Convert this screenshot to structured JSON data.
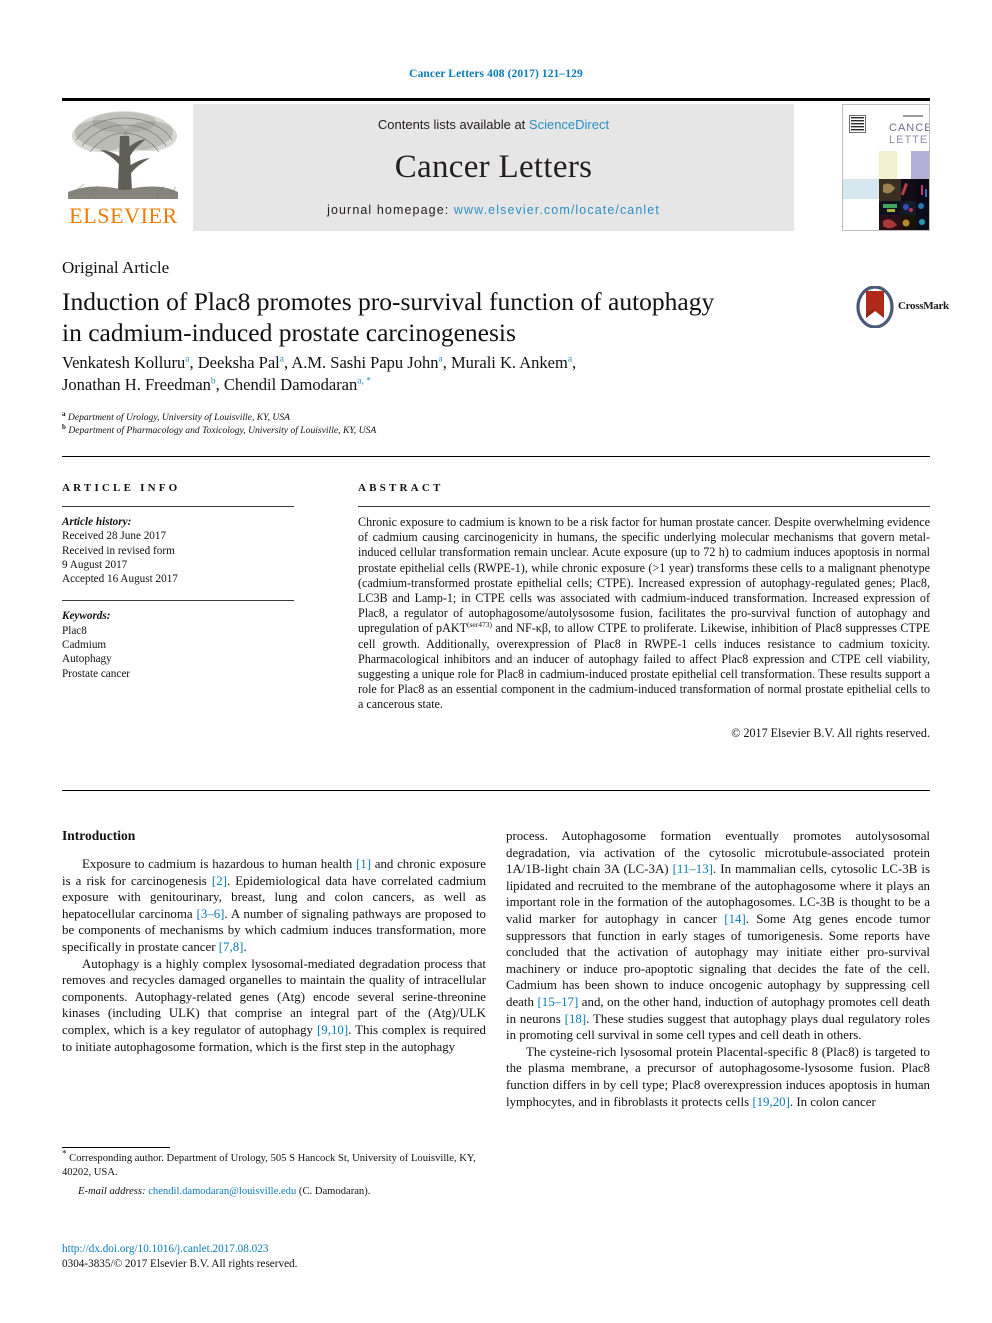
{
  "running_head": "Cancer Letters 408 (2017) 121–129",
  "banner": {
    "contents_prefix": "Contents lists available at ",
    "sciencedirect": "ScienceDirect",
    "journal_title": "Cancer Letters",
    "homepage_prefix": "journal homepage: ",
    "homepage_url": "www.elsevier.com/locate/canlet",
    "publisher": "ELSEVIER",
    "publisher_color": "#ef7c00",
    "link_color": "#2a8fc4",
    "cover_title_line1": "CANCER",
    "cover_title_line2": "LETTERS"
  },
  "article": {
    "type": "Original Article",
    "title_line1": "Induction of Plac8 promotes pro-survival function of autophagy",
    "title_line2": "in cadmium-induced prostate carcinogenesis",
    "crossmark_label": "CrossMark",
    "authors": [
      {
        "name": "Venkatesh Kolluru",
        "marks": "a",
        "sep": ", "
      },
      {
        "name": "Deeksha Pal",
        "marks": "a",
        "sep": ", "
      },
      {
        "name": "A.M. Sashi Papu John",
        "marks": "a",
        "sep": ", "
      },
      {
        "name": "Murali K. Ankem",
        "marks": "a",
        "sep": ", "
      },
      {
        "name": "Jonathan H. Freedman",
        "marks": "b",
        "sep": ", "
      },
      {
        "name": "Chendil Damodaran",
        "marks": "a, *",
        "sep": ""
      }
    ],
    "affiliations": [
      {
        "mark": "a",
        "text": "Department of Urology, University of Louisville, KY, USA"
      },
      {
        "mark": "b",
        "text": "Department of Pharmacology and Toxicology, University of Louisville, KY, USA"
      }
    ]
  },
  "article_info": {
    "heading": "ARTICLE INFO",
    "history_label": "Article history:",
    "history_lines": [
      "Received 28 June 2017",
      "Received in revised form",
      "9 August 2017",
      "Accepted 16 August 2017"
    ],
    "keywords_label": "Keywords:",
    "keywords": [
      "Plac8",
      "Cadmium",
      "Autophagy",
      "Prostate cancer"
    ]
  },
  "abstract": {
    "heading": "ABSTRACT",
    "text_before_sup": "Chronic exposure to cadmium is known to be a risk factor for human prostate cancer. Despite overwhelming evidence of cadmium causing carcinogenicity in humans, the specific underlying molecular mechanisms that govern metal-induced cellular transformation remain unclear. Acute exposure (up to 72 h) to cadmium induces apoptosis in normal prostate epithelial cells (RWPE-1), while chronic exposure (>1 year) transforms these cells to a malignant phenotype (cadmium-transformed prostate epithelial cells; CTPE). Increased expression of autophagy-regulated genes; Plac8, LC3B and Lamp-1; in CTPE cells was associated with cadmium-induced transformation. Increased expression of Plac8, a regulator of autophagosome/autolysosome fusion, facilitates the pro-survival function of autophagy and upregulation of pAKT",
    "superscript": "(ser473)",
    "text_after_sup": " and NF-κβ, to allow CTPE to proliferate. Likewise, inhibition of Plac8 suppresses CTPE cell growth. Additionally, overexpression of Plac8 in RWPE-1 cells induces resistance to cadmium toxicity. Pharmacological inhibitors and an inducer of autophagy failed to affect Plac8 expression and CTPE cell viability, suggesting a unique role for Plac8 in cadmium-induced prostate epithelial cell transformation. These results support a role for Plac8 as an essential component in the cadmium-induced transformation of normal prostate epithelial cells to a cancerous state.",
    "copyright": "© 2017 Elsevier B.V. All rights reserved."
  },
  "body": {
    "intro_heading": "Introduction",
    "left_paragraphs": [
      "Exposure to cadmium is hazardous to human health [1] and chronic exposure is a risk for carcinogenesis [2]. Epidemiological data have correlated cadmium exposure with genitourinary, breast, lung and colon cancers, as well as hepatocellular carcinoma [3–6]. A number of signaling pathways are proposed to be components of mechanisms by which cadmium induces transformation, more specifically in prostate cancer [7,8].",
      "Autophagy is a highly complex lysosomal-mediated degradation process that removes and recycles damaged organelles to maintain the quality of intracellular components. Autophagy-related genes (Atg) encode several serine-threonine kinases (including ULK) that comprise an integral part of the (Atg)/ULK complex, which is a key regulator of autophagy [9,10]. This complex is required to initiate autophagosome formation, which is the first step in the autophagy"
    ],
    "right_paragraphs": [
      "process. Autophagosome formation eventually promotes autolysosomal degradation, via activation of the cytosolic microtubule-associated protein 1A/1B-light chain 3A (LC-3A) [11–13]. In mammalian cells, cytosolic LC-3B is lipidated and recruited to the membrane of the autophagosome where it plays an important role in the formation of the autophagosomes. LC-3B is thought to be a valid marker for autophagy in cancer [14]. Some Atg genes encode tumor suppressors that function in early stages of tumorigenesis. Some reports have concluded that the activation of autophagy may initiate either pro-survival machinery or induce pro-apoptotic signaling that decides the fate of the cell. Cadmium has been shown to induce oncogenic autophagy by suppressing cell death [15–17] and, on the other hand, induction of autophagy promotes cell death in neurons [18]. These studies suggest that autophagy plays dual regulatory roles in promoting cell survival in some cell types and cell death in others.",
      "The cysteine-rich lysosomal protein Placental-specific 8 (Plac8) is targeted to the plasma membrane, a precursor of autophagosome-lysosome fusion. Plac8 function differs in by cell type; Plac8 overexpression induces apoptosis in human lymphocytes, and in fibroblasts it protects cells [19,20]. In colon cancer"
    ]
  },
  "footnotes": {
    "corresponding": "Corresponding author. Department of Urology, 505 S Hancock St, University of Louisville, KY, 40202, USA.",
    "email_label": "E-mail address:",
    "email": "chendil.damodaran@louisville.edu",
    "email_suffix": "(C. Damodaran).",
    "doi": "http://dx.doi.org/10.1016/j.canlet.2017.08.023",
    "issn_line": "0304-3835/© 2017 Elsevier B.V. All rights reserved."
  }
}
